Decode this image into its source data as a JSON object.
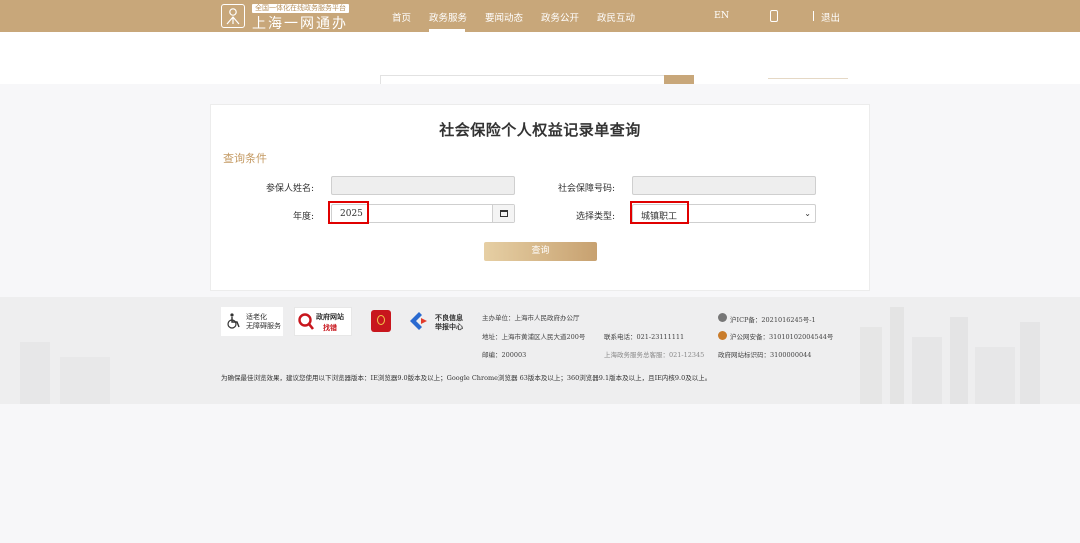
{
  "header": {
    "tagline": "全国一体化在线政务服务平台",
    "site_title": "上海一网通办",
    "nav": [
      "首页",
      "政务服务",
      "要闻动态",
      "政务公开",
      "政民互动"
    ],
    "active_nav": "政务服务",
    "lang": "EN",
    "logout": "退出"
  },
  "page": {
    "title": "社会保险个人权益记录单查询",
    "section": "查询条件",
    "name_label": "参保人姓名:",
    "name_value": "",
    "ss_label": "社会保障号码:",
    "ss_value": "",
    "year_label": "年度:",
    "year_value": "2025",
    "type_label": "选择类型:",
    "type_value": "城镇职工",
    "query_button": "查询"
  },
  "footer": {
    "badge_accessibility_line1": "适老化",
    "badge_accessibility_line2": "无障碍服务",
    "badge_report_line1": "政府网站",
    "badge_report_line2": "找错",
    "badge_bad_info_line1": "不良信息",
    "badge_bad_info_line2": "举报中心",
    "host": "主办单位：上海市人民政府办公厅",
    "address": "地址：上海市黄浦区人民大道200号",
    "zipcode": "邮编：200003",
    "phone": "联系电话：021-23111111",
    "service_line": "上海政务服务总客服：021-12345",
    "icp": "沪ICP备：2021016245号-1",
    "police": "沪公网安备：31010102004544号",
    "site_id": "政府网站标识码：3100000044",
    "browser_note": "为确保最佳浏览效果，建议您使用以下浏览器版本：IE浏览器9.0版本及以上；Google Chrome浏览器 63版本及以上；360浏览器9.1版本及以上，且IE内核9.0及以上。"
  },
  "colors": {
    "brand_gold": "#c8a77a",
    "highlight_red": "#e00000"
  }
}
